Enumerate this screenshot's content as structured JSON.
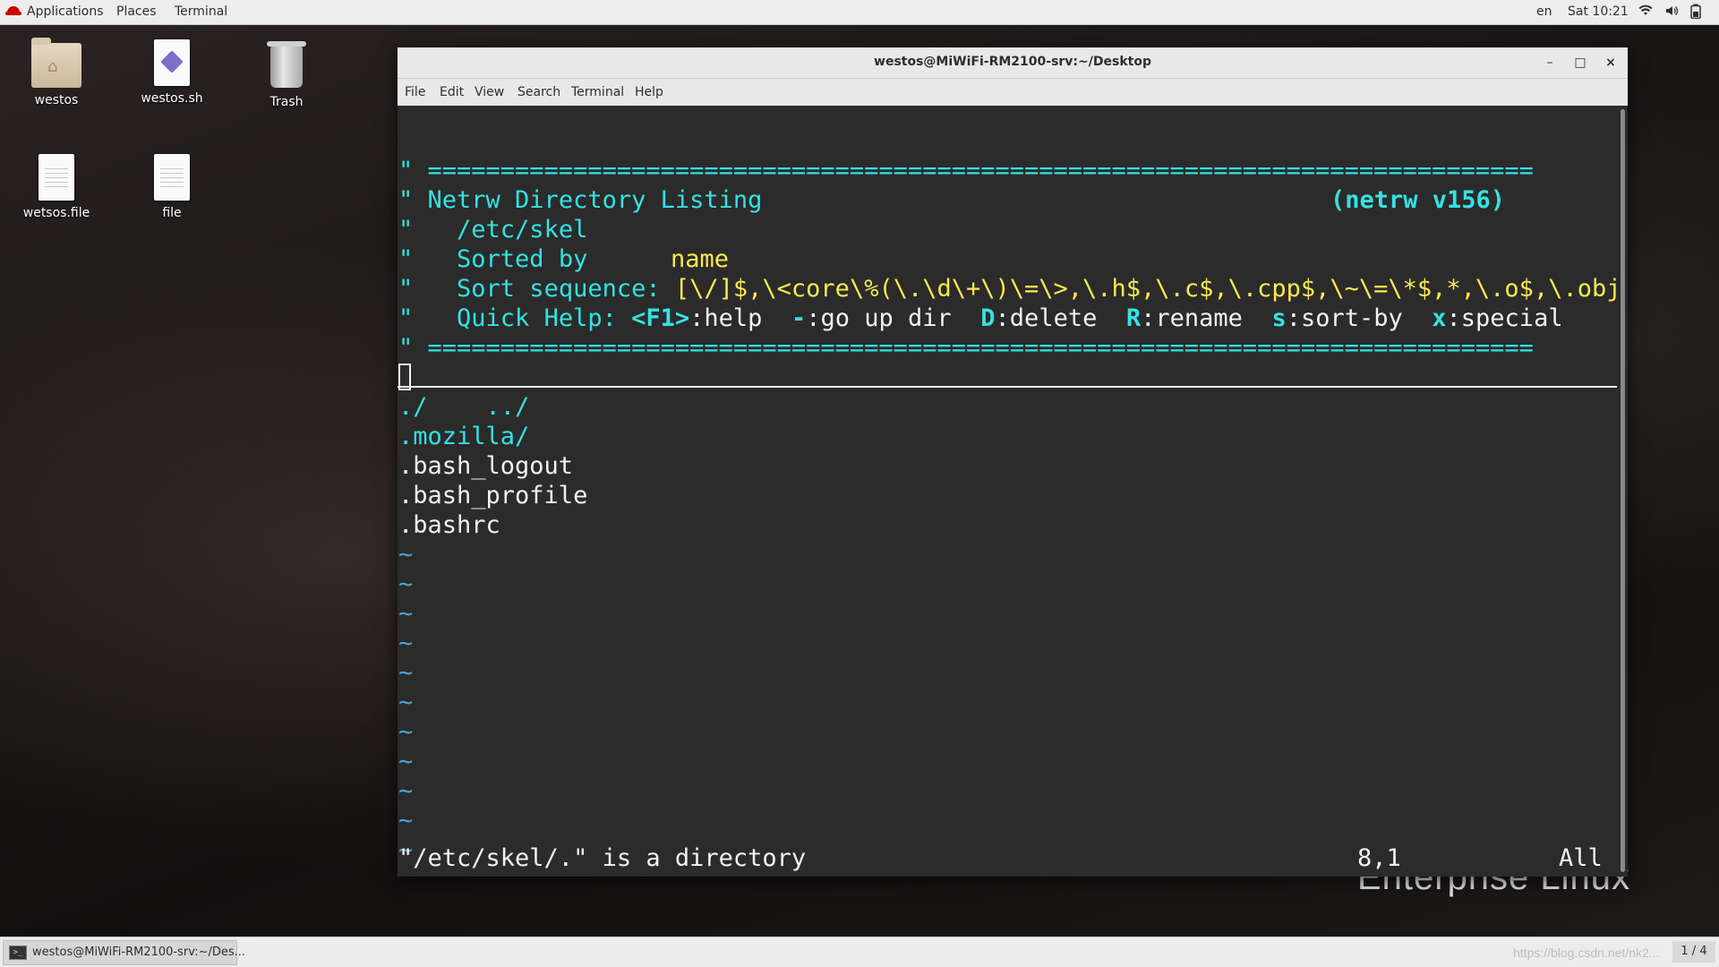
{
  "topbar": {
    "applications": "Applications",
    "places": "Places",
    "terminal": "Terminal",
    "language": "en",
    "clock": "Sat 10:21"
  },
  "desktop": {
    "icons": [
      {
        "label": "westos",
        "icon": "home-folder-icon"
      },
      {
        "label": "westos.sh",
        "icon": "script-file-icon"
      },
      {
        "label": "Trash",
        "icon": "trash-icon"
      },
      {
        "label": "wetsos.file",
        "icon": "text-file-icon"
      },
      {
        "label": "file",
        "icon": "text-file-icon"
      }
    ],
    "wallpaper_text": "Enterprise Linux"
  },
  "window": {
    "title": "westos@MiWiFi-RM2100-srv:~/Desktop",
    "menu": [
      "File",
      "Edit",
      "View",
      "Search",
      "Terminal",
      "Help"
    ]
  },
  "terminal": {
    "rule": "\" ============================================================================",
    "rule2": "\" ============================================================================",
    "header_title": "Netrw Directory Listing",
    "header_version": "(netrw v156)",
    "path": "/etc/skel",
    "sorted_by_label": "Sorted by",
    "sorted_by_value": "name",
    "sort_seq_label": "Sort sequence:",
    "sort_seq_value": "[\\/]$,\\<core\\%(\\.\\d\\+\\)\\=\\>,\\.h$,\\.c$,\\.cpp$,\\~\\=\\*$,*,\\.o$,\\.obj$",
    "quick_help_label": "Quick Help:",
    "quick_help": {
      "k1": "<F1>",
      "v1": ":help",
      "k2": "-",
      "v2": ":go up dir",
      "k3": "D",
      "v3": ":delete",
      "k4": "R",
      "v4": ":rename",
      "k5": "s",
      "v5": ":sort-by",
      "k6": "x",
      "v6": ":special"
    },
    "entries": [
      "../",
      "./",
      ".mozilla/",
      ".bash_logout",
      ".bash_profile",
      ".bashrc"
    ],
    "tilde": "~",
    "status_message": "\"/etc/skel/.\" is a directory",
    "status_position": "8,1",
    "status_scroll": "All"
  },
  "taskbar": {
    "task_label": "westos@MiWiFi-RM2100-srv:~/Des...",
    "watermark": "https://blog.csdn.net/nk2...",
    "workspace": "1 / 4"
  }
}
